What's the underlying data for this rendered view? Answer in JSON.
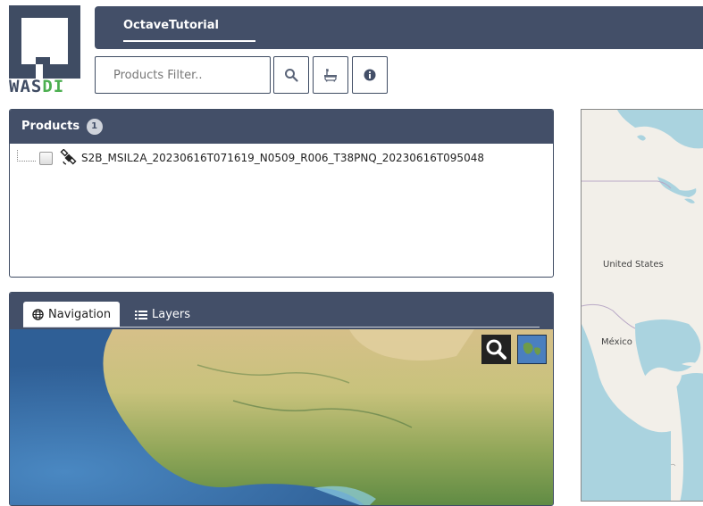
{
  "logo": {
    "text_main": "WAS",
    "text_accent": "DI"
  },
  "topbar": {
    "active_tab": "OctaveTutorial"
  },
  "filter": {
    "placeholder": "Products Filter.."
  },
  "toolbar": {
    "search_icon": "search-icon",
    "workflow_icon": "bathtub-icon",
    "info_icon": "info-icon"
  },
  "products": {
    "title": "Products",
    "count": "1",
    "items": [
      {
        "name": "S2B_MSIL2A_20230616T071619_N0509_R006_T38PNQ_20230616T095048",
        "icon": "satellite-icon"
      }
    ]
  },
  "navigation": {
    "tabs": [
      {
        "label": "Navigation",
        "icon": "globe-icon",
        "active": true
      },
      {
        "label": "Layers",
        "icon": "list-icon",
        "active": false
      }
    ]
  },
  "world_map": {
    "labels": [
      "United States",
      "México"
    ]
  },
  "colors": {
    "header_bg": "#434f68",
    "accent_green": "#4caf50",
    "ocean": "#3b6fa8",
    "land": "#c8c27c"
  }
}
